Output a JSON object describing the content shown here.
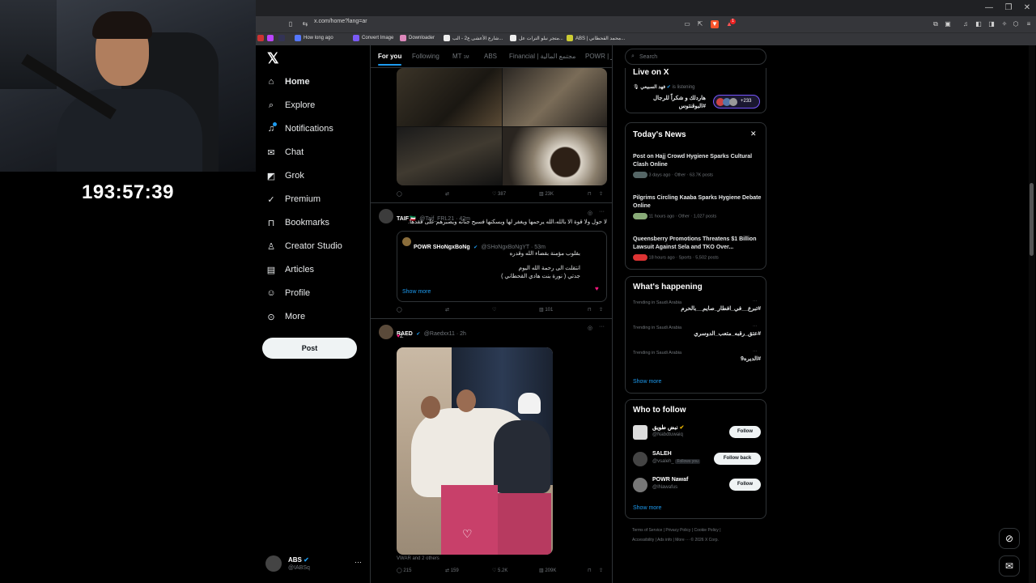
{
  "stream": {
    "timer": "193:57:39"
  },
  "browser": {
    "url": "x.com/home?lang=ar",
    "bookmarks": [
      "How long ago",
      "Convert Image",
      "Downloader",
      "شارع الأعشى ع2 - الب...",
      "متجر نبلو الترات عل...",
      "ABS | محمد القحطاني..."
    ],
    "notif_badge": "1"
  },
  "nav": {
    "items": [
      "Home",
      "Explore",
      "Notifications",
      "Chat",
      "Grok",
      "Premium",
      "Bookmarks",
      "Creator Studio",
      "Articles",
      "Profile",
      "More"
    ],
    "icons": [
      "home-icon",
      "search-icon",
      "bell-icon",
      "chat-icon",
      "grok-icon",
      "premium-icon",
      "bookmark-icon",
      "creator-studio-icon",
      "articles-icon",
      "profile-icon",
      "more-icon"
    ],
    "post_label": "Post",
    "account": {
      "name": "ABS",
      "handle": "@IABSq"
    }
  },
  "feed": {
    "tabs": [
      "For you",
      "Following",
      "MT",
      "ABS",
      "Financial | مجتمع المالية",
      "POWR | ور"
    ],
    "mt_badge": "1M",
    "tweet1": {
      "replies": "",
      "reposts": "",
      "likes": "387",
      "views": "23K"
    },
    "tweet2": {
      "name": "TAIF",
      "flag": "🇰🇼",
      "handle": "@Taif_FRL21",
      "time": "42m",
      "text": "لا حول ولا قوة الا بالله،الله يرحمها ويغفر لها ويسكنها فسيح جناته ويصبرهم على فقدها.",
      "quote": {
        "name": "POWR SHoNgxBoNg",
        "handle": "@SHoNgxBoNgYT",
        "time": "53m",
        "line1": "بقلوب مؤمنة بقضاء الله وقدره",
        "line2": "انتقلت الى رحمة الله اليوم",
        "line3": "جدتي ( نورة بنت هادي القحطاني )",
        "show_more": "Show more"
      },
      "views": "101"
    },
    "tweet3": {
      "name": "RAED",
      "handle": "@Raedxx11",
      "time": "2h",
      "text": "Z",
      "caption": "VWAR and 2 others",
      "replies": "215",
      "reposts": "159",
      "likes": "5.2K",
      "views": "209K"
    }
  },
  "sidebar": {
    "search_placeholder": "Search",
    "live": {
      "title": "Live on X",
      "host": "فهد السبيعي",
      "status": "is listening",
      "text": "هاردلك و شكراً للرجال #البوقنتوس",
      "count": "+233"
    },
    "news": {
      "title": "Today's News",
      "items": [
        {
          "title": "Post on Hajj Crowd Hygiene Sparks Cultural Clash Online",
          "meta": "3 days ago · Other · 63.7K posts"
        },
        {
          "title": "Pilgrims Circling Kaaba Sparks Hygiene Debate Online",
          "meta": "11 hours ago · Other · 1,027 posts"
        },
        {
          "title": "Queensberry Promotions Threatens $1 Billion Lawsuit Against Sela and TKO Over...",
          "meta": "18 hours ago · Sports · 5,502 posts"
        }
      ]
    },
    "happening": {
      "title": "What's happening",
      "items": [
        {
          "context": "Trending in Saudi Arabia",
          "tag": "#تبرع__في_افطار_صايم__بالحرم"
        },
        {
          "context": "Trending in Saudi Arabia",
          "tag": "#عتق_رقبه_متعب_الدوسري"
        },
        {
          "context": "Trending in Saudi Arabia",
          "tag": "#الديره9"
        }
      ],
      "show_more": "Show more"
    },
    "who_to_follow": {
      "title": "Who to follow",
      "items": [
        {
          "name": "نبض طويق",
          "handle": "@Nabdtuwaiq",
          "button": "Follow",
          "follows_you": ""
        },
        {
          "name": "SALEH",
          "handle": "@vsaleh_",
          "button": "Follow back",
          "follows_you": "Follows you"
        },
        {
          "name": "POWR Nawaf",
          "handle": "@INawafus",
          "button": "Follow",
          "follows_you": ""
        }
      ],
      "show_more": "Show more"
    },
    "footer": [
      "Terms of Service",
      "Privacy Policy",
      "Cookie Policy",
      "Accessibility",
      "Ads info",
      "More ···",
      "© 2026 X Corp."
    ]
  }
}
